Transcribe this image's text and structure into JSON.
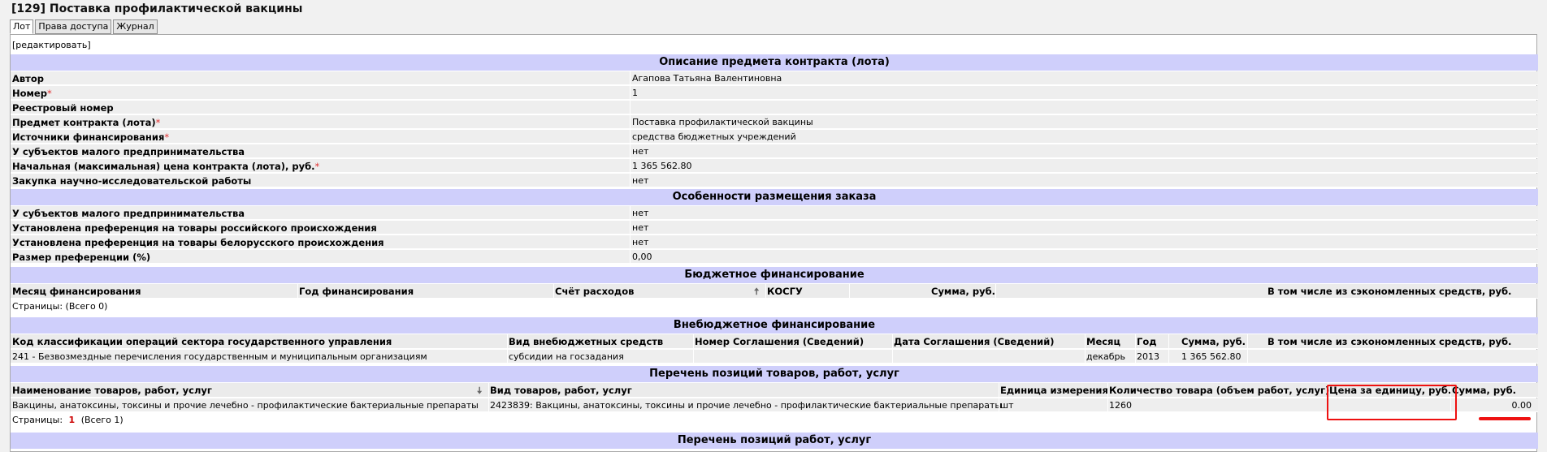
{
  "page": {
    "title": "[129] Поставка профилактической вакцины"
  },
  "tabs": [
    {
      "label": "Лот",
      "active": true
    },
    {
      "label": "Права доступа",
      "active": false
    },
    {
      "label": "Журнал",
      "active": false
    }
  ],
  "edit_link": "[редактировать]",
  "description": {
    "title": "Описание предмета контракта (лота)",
    "rows": [
      {
        "label": "Автор",
        "required": false,
        "value": "Агапова Татьяна Валентиновна"
      },
      {
        "label": "Номер",
        "required": true,
        "value": "1"
      },
      {
        "label": "Реестровый номер",
        "required": false,
        "value": ""
      },
      {
        "label": "Предмет контракта (лота)",
        "required": true,
        "value": "Поставка профилактической вакцины"
      },
      {
        "label": "Источники финансирования",
        "required": true,
        "value": "средства бюджетных учреждений"
      },
      {
        "label": "У субъектов малого предпринимательства",
        "required": false,
        "value": "нет"
      },
      {
        "label": "Начальная (максимальная) цена контракта (лота), руб.",
        "required": true,
        "value": "1 365 562.80"
      },
      {
        "label": "Закупка научно-исследовательской работы",
        "required": false,
        "value": "нет"
      }
    ]
  },
  "features": {
    "title": "Особенности размещения заказа",
    "rows": [
      {
        "label": "У субъектов малого предпринимательства",
        "value": "нет"
      },
      {
        "label": "Установлена преференция на товары российского происхождения",
        "value": "нет"
      },
      {
        "label": "Установлена преференция на товары белорусского происхождения",
        "value": "нет"
      },
      {
        "label": "Размер преференции (%)",
        "value": "0,00"
      }
    ]
  },
  "budget": {
    "title": "Бюджетное финансирование",
    "columns": [
      "Месяц финансирования",
      "Год финансирования",
      "Счёт расходов",
      "КОСГУ",
      "Сумма, руб.",
      "В том числе из сэкономленных средств, руб."
    ],
    "pager": "Страницы:  (Всего 0)"
  },
  "offbudget": {
    "title": "Внебюджетное финансирование",
    "columns": [
      "Код классификации операций сектора государственного управления",
      "Вид внебюджетных средств",
      "Номер Соглашения (Сведений)",
      "Дата Соглашения (Сведений)",
      "Месяц",
      "Год",
      "Сумма, руб.",
      "В том числе из сэкономленных средств, руб."
    ],
    "row": [
      "241 - Безвозмездные перечисления государственным и муниципальным организациям",
      "субсидии на госзадания",
      "",
      "",
      "декабрь",
      "2013",
      "1 365 562.80",
      ""
    ]
  },
  "goods": {
    "title": "Перечень позиций товаров, работ, услуг",
    "columns": [
      "Наименование товаров, работ, услуг",
      "Вид товаров, работ, услуг",
      "Единица измерения",
      "Количество товара (объем работ, услуг)",
      "Цена за единицу, руб.",
      "Сумма, руб."
    ],
    "row": [
      "Вакцины, анатоксины, токсины и прочие лечебно - профилактические бактериальные препараты",
      "2423839: Вакцины, анатоксины, токсины и прочие лечебно - профилактические бактериальные препараты",
      "шт",
      "1260",
      "",
      "0.00"
    ],
    "pager_label": "Страницы:",
    "pager_current": "1",
    "pager_total": "(Всего 1)"
  },
  "works": {
    "title": "Перечень позиций работ, услуг"
  },
  "colors": {
    "section_bg": "#cfcffb",
    "row_bg": "#eeeeee",
    "required": "#e03030",
    "highlight": "#ee1111"
  }
}
